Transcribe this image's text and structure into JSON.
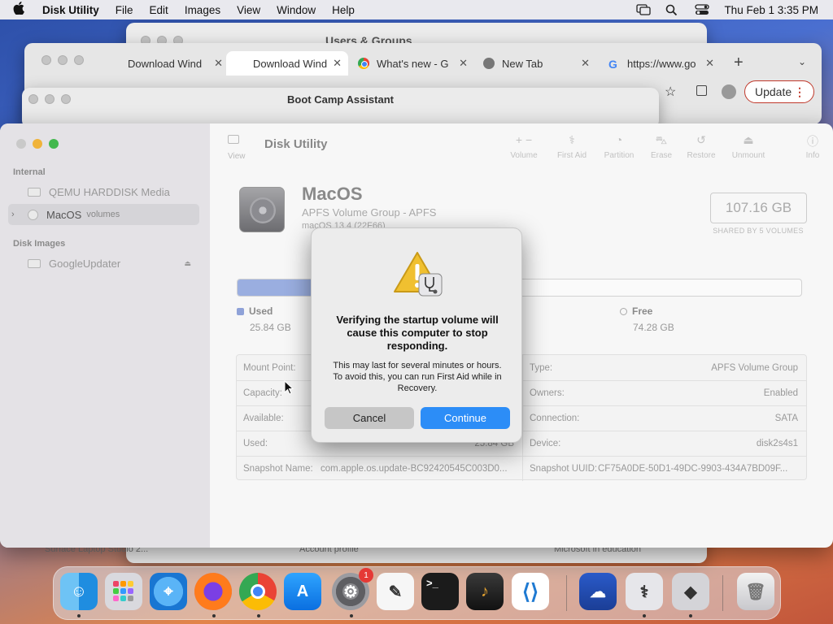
{
  "menubar": {
    "app_name": "Disk Utility",
    "items": [
      "File",
      "Edit",
      "Images",
      "View",
      "Window",
      "Help"
    ],
    "clock": "Thu Feb 1  3:35 PM"
  },
  "users_window": {
    "title": "Users & Groups",
    "footer": [
      "Surface Laptop Studio 2...",
      "Account profile",
      "Microsoft in education"
    ]
  },
  "chrome": {
    "tabs": [
      {
        "label": "Download Wind"
      },
      {
        "label": "Download Wind"
      },
      {
        "label": "What's new - G"
      },
      {
        "label": "New Tab"
      },
      {
        "label": "https://www.go"
      }
    ],
    "update_label": "Update"
  },
  "bootcamp": {
    "title": "Boot Camp Assistant"
  },
  "disk_utility": {
    "title": "Disk Utility",
    "view_label": "View",
    "toolbar": [
      {
        "label": "Volume",
        "icon": "+ −"
      },
      {
        "label": "First Aid",
        "icon": "⚕"
      },
      {
        "label": "Partition",
        "icon": "◔"
      },
      {
        "label": "Erase",
        "icon": "⛍"
      },
      {
        "label": "Restore",
        "icon": "↺"
      },
      {
        "label": "Unmount",
        "icon": "⏏"
      },
      {
        "label": "Info",
        "icon": "ⓘ"
      }
    ],
    "sidebar": {
      "section_internal": "Internal",
      "section_images": "Disk Images",
      "items": [
        {
          "label": "QEMU HARDDISK Media"
        },
        {
          "label": "MacOS",
          "sub": "volumes"
        },
        {
          "label": "GoogleUpdater"
        }
      ]
    },
    "volume": {
      "name": "MacOS",
      "subtitle": "APFS Volume Group - APFS",
      "os": "macOS 13.4 (22F66)",
      "capacity": "107.16 GB",
      "shared": "SHARED BY 5 VOLUMES",
      "used_fraction": 0.241,
      "used_label": "Used",
      "used_value": "25.84 GB",
      "free_label": "Free",
      "free_value": "74.28 GB"
    },
    "info_left": [
      {
        "k": "Mount Point:",
        "v": ""
      },
      {
        "k": "Capacity:",
        "v": ""
      },
      {
        "k": "Available:",
        "v": ""
      },
      {
        "k": "Used:",
        "v": "25.84 GB"
      },
      {
        "k": "Snapshot Name:",
        "v": "com.apple.os.update-BC92420545C003D0..."
      }
    ],
    "info_right": [
      {
        "k": "Type:",
        "v": "APFS Volume Group"
      },
      {
        "k": "Owners:",
        "v": "Enabled"
      },
      {
        "k": "Connection:",
        "v": "SATA"
      },
      {
        "k": "Device:",
        "v": "disk2s4s1"
      },
      {
        "k": "Snapshot UUID:",
        "v": "CF75A0DE-50D1-49DC-9903-434A7BD09F..."
      }
    ]
  },
  "alert": {
    "title": "Verifying the startup volume will cause this computer to stop responding.",
    "message": "This may last for several minutes or hours. To avoid this, you can run First Aid while in Recovery.",
    "cancel": "Cancel",
    "continue": "Continue"
  },
  "dock": {
    "badge": "1",
    "apps": [
      "Finder",
      "Launchpad",
      "Safari",
      "Firefox",
      "Chrome",
      "App Store",
      "System Settings",
      "TextEdit",
      "Terminal",
      "GarageBand",
      "Visual Studio Code",
      "Weather",
      "Disk Utility",
      "Boot Camp Assistant",
      "Trash"
    ]
  },
  "colors": {
    "accent": "#2c8df7",
    "used": "#8fa2d8"
  }
}
